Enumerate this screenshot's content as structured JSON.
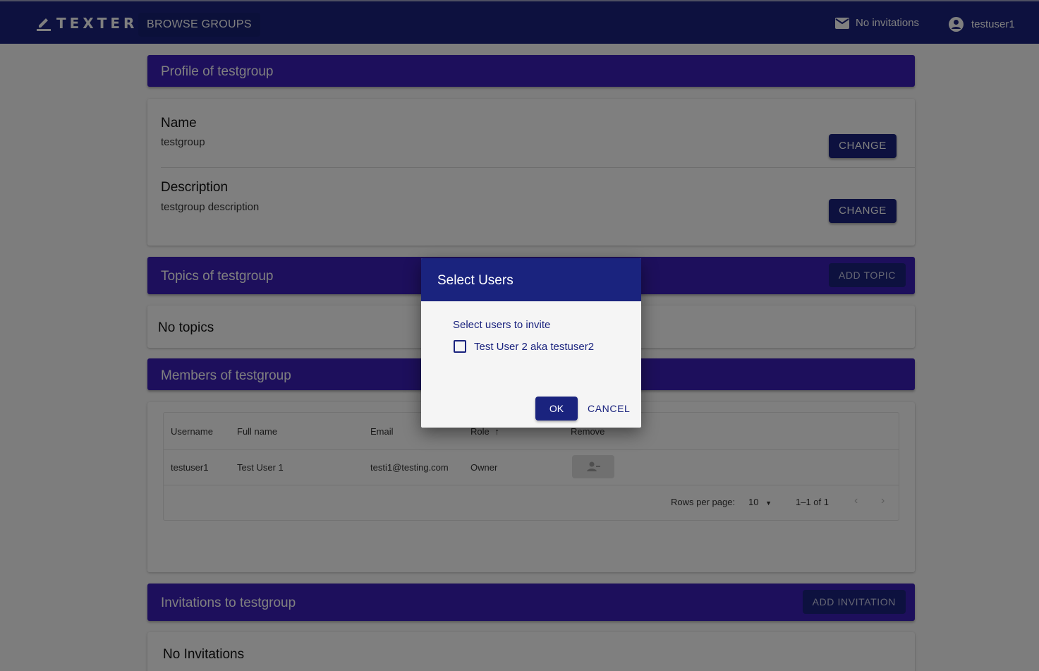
{
  "appbar": {
    "logo_text": "TEXTER",
    "browse_label": "BROWSE GROUPS",
    "invitations_label": "No invitations",
    "username": "testuser1"
  },
  "profile": {
    "header": "Profile of testgroup",
    "name_label": "Name",
    "name_value": "testgroup",
    "description_label": "Description",
    "description_value": "testgroup description",
    "change_label": "CHANGE"
  },
  "topics": {
    "header": "Topics of testgroup",
    "add_label": "ADD TOPIC",
    "empty_text": "No topics"
  },
  "members": {
    "header": "Members of testgroup",
    "columns": [
      "Username",
      "Full name",
      "Email",
      "Role",
      "Remove"
    ],
    "rows": [
      {
        "username": "testuser1",
        "full_name": "Test User 1",
        "email": "testi1@testing.com",
        "role": "Owner"
      }
    ],
    "rows_per_page_label": "Rows per page:",
    "rows_per_page_value": "10",
    "range_text": "1–1 of 1"
  },
  "invitations": {
    "header": "Invitations to testgroup",
    "add_label": "ADD INVITATION",
    "empty_text": "No Invitations"
  },
  "dialog": {
    "title": "Select Users",
    "subtitle": "Select users to invite",
    "options": [
      {
        "label": "Test User 2 aka testuser2",
        "checked": false
      }
    ],
    "ok_label": "OK",
    "cancel_label": "CANCEL"
  },
  "colors": {
    "appbar": "#1a237e",
    "section_header": "#3a1fb8",
    "button": "#1a237e"
  }
}
